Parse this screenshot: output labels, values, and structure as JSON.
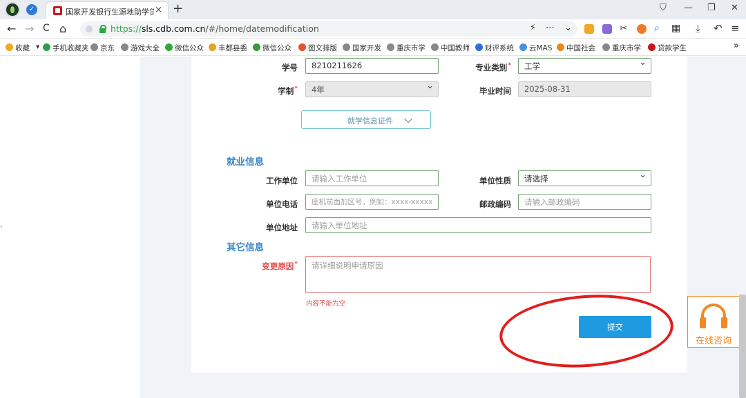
{
  "browser": {
    "tab_title": "国家开发银行生源地助学贷款",
    "tab_close": "×",
    "new_tab": "+",
    "window_controls": [
      "⛉",
      "—",
      "❐",
      "✕"
    ],
    "nav_icons": [
      "←",
      "→",
      "C",
      "⌂"
    ],
    "url": {
      "scheme": "https://",
      "host": "sls.cdb.com.cn",
      "path": "/#/home/datemodification"
    },
    "url_icons": "⚡ ⋯ ⌄",
    "toolbar_icons": [
      "✂",
      "⌕",
      "▦",
      "⤓",
      "↶",
      "≡"
    ],
    "bookmarks": [
      {
        "label": "收藏",
        "color": "#f5a623"
      },
      {
        "label": "▾",
        "color": "transparent"
      },
      {
        "label": "手机收藏夹",
        "color": "#2e9e4b"
      },
      {
        "label": "京东",
        "color": "#888888"
      },
      {
        "label": "游戏大全",
        "color": "#888888"
      },
      {
        "label": "微信公众",
        "color": "#2eaa3a"
      },
      {
        "label": "丰都县委",
        "color": "#e6a12a"
      },
      {
        "label": "微信公众",
        "color": "#3a9a3a"
      },
      {
        "label": "图文排版",
        "color": "#e2502c"
      },
      {
        "label": "国家开发",
        "color": "#888888"
      },
      {
        "label": "重庆市学",
        "color": "#888888"
      },
      {
        "label": "中国教师",
        "color": "#888888"
      },
      {
        "label": "财评系统",
        "color": "#2f6fd6"
      },
      {
        "label": "云MAS",
        "color": "#4a90e2"
      },
      {
        "label": "中国社会",
        "color": "#e88a1a"
      },
      {
        "label": "重庆市学",
        "color": "#888888"
      },
      {
        "label": "贷款学生",
        "color": "#c8171e"
      }
    ],
    "bookmarks_more": "»"
  },
  "form": {
    "student_id": {
      "label": "学号",
      "value": "8210211626"
    },
    "major_type": {
      "label": "专业类别",
      "required": "*",
      "value": "工学"
    },
    "duration": {
      "label": "学制",
      "required": "*",
      "value": "4年"
    },
    "graduation": {
      "label": "毕业时间",
      "value": "2025-08-31"
    },
    "expand_button": {
      "label": "就学信息证件",
      "chevron": "⌵"
    },
    "employment_section": "就业信息",
    "employer": {
      "label": "工作单位",
      "placeholder": "请输入工作单位"
    },
    "employer_type": {
      "label": "单位性质",
      "value": "请选择"
    },
    "employer_phone": {
      "label": "单位电话",
      "placeholder": "座机前面加区号，例如：xxxx-xxxxx"
    },
    "postal_code": {
      "label": "邮政编码",
      "placeholder": "请输入邮政编码"
    },
    "employer_address": {
      "label": "单位地址",
      "placeholder": "请输入单位地址"
    },
    "other_section": "其它信息",
    "change_reason": {
      "label": "变更原因",
      "required": "*",
      "placeholder": "请详细说明申请原因",
      "error": "内容不能为空"
    },
    "submit_label": "提交"
  },
  "consult": {
    "label": "在线咨询",
    "color": "#f08a24"
  },
  "colors": {
    "accent": "#1e9be0",
    "section": "#3a86c8",
    "error": "#e24a4a",
    "highlight": "#e11d1d"
  }
}
